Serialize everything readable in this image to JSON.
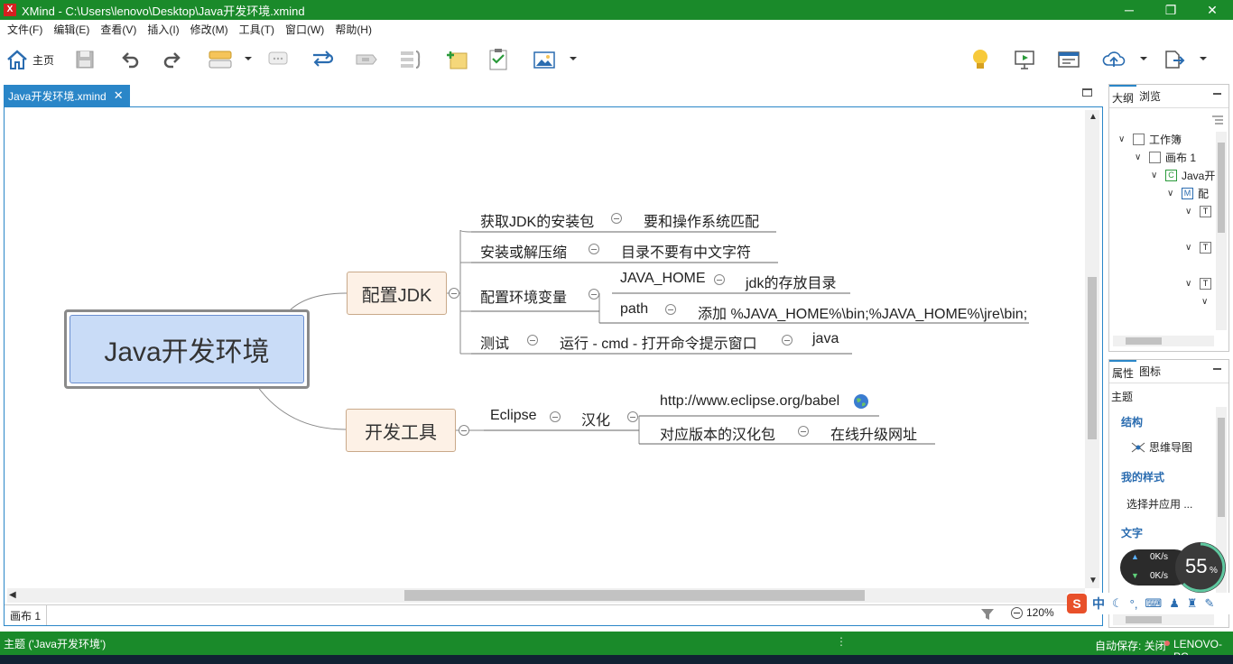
{
  "window": {
    "title": "XMind - C:\\Users\\lenovo\\Desktop\\Java开发环境.xmind",
    "app_icon": "X",
    "controls": [
      "─",
      "❐",
      "✕"
    ]
  },
  "menu": [
    "文件(F)",
    "编辑(E)",
    "查看(V)",
    "插入(I)",
    "修改(M)",
    "工具(T)",
    "窗口(W)",
    "帮助(H)"
  ],
  "toolbar": {
    "home_label": "主页"
  },
  "editor_tab": {
    "label": "Java开发环境.xmind",
    "close": "✕"
  },
  "mindmap": {
    "central": "Java开发环境",
    "branches": [
      {
        "label": "配置JDK",
        "children": [
          {
            "label": "获取JDK的安装包",
            "note": "要和操作系统匹配"
          },
          {
            "label": "安装或解压缩",
            "note": "目录不要有中文字符"
          },
          {
            "label": "配置环境变量",
            "children": [
              {
                "label": "JAVA_HOME",
                "note": "jdk的存放目录"
              },
              {
                "label": "path",
                "note": "添加 %JAVA_HOME%\\bin;%JAVA_HOME%\\jre\\bin;"
              }
            ]
          },
          {
            "label": "测试",
            "step": "运行 - cmd - 打开命令提示窗口",
            "note": "java"
          }
        ]
      },
      {
        "label": "开发工具",
        "children": [
          {
            "label": "Eclipse",
            "step": "汉化",
            "children": [
              {
                "label": "http://www.eclipse.org/babel"
              },
              {
                "label": "对应版本的汉化包",
                "note": "在线升级网址"
              }
            ]
          }
        ]
      }
    ]
  },
  "canvas_status": {
    "sheet": "画布 1",
    "zoom": "120%"
  },
  "outline_panel": {
    "tabs": [
      "大纲",
      "浏览"
    ],
    "tree": [
      {
        "label": "工作簿"
      },
      {
        "label": "画布 1"
      },
      {
        "label": "Java开"
      },
      {
        "label": "配"
      }
    ]
  },
  "props_panel": {
    "tabs": [
      "属性",
      "图标"
    ],
    "heading": "主题",
    "structure_title": "结构",
    "structure_value": "思维导图",
    "style_title": "我的样式",
    "style_value": "选择并应用 ...",
    "text_title": "文字"
  },
  "speed_widget": {
    "up": "0K/s",
    "down": "0K/s",
    "percent": "55",
    "percent_sign": "%"
  },
  "ime": {
    "label": "中"
  },
  "statusbar": {
    "left": "主题 ('Java开发环境')",
    "right": "自动保存: 关闭",
    "user": "LENOVO-PC"
  },
  "colors": {
    "title_green": "#1a8a2a",
    "tab_blue": "#2a86c8",
    "central_fill": "#c9dcf7",
    "topic_fill": "#fdf1e6"
  }
}
